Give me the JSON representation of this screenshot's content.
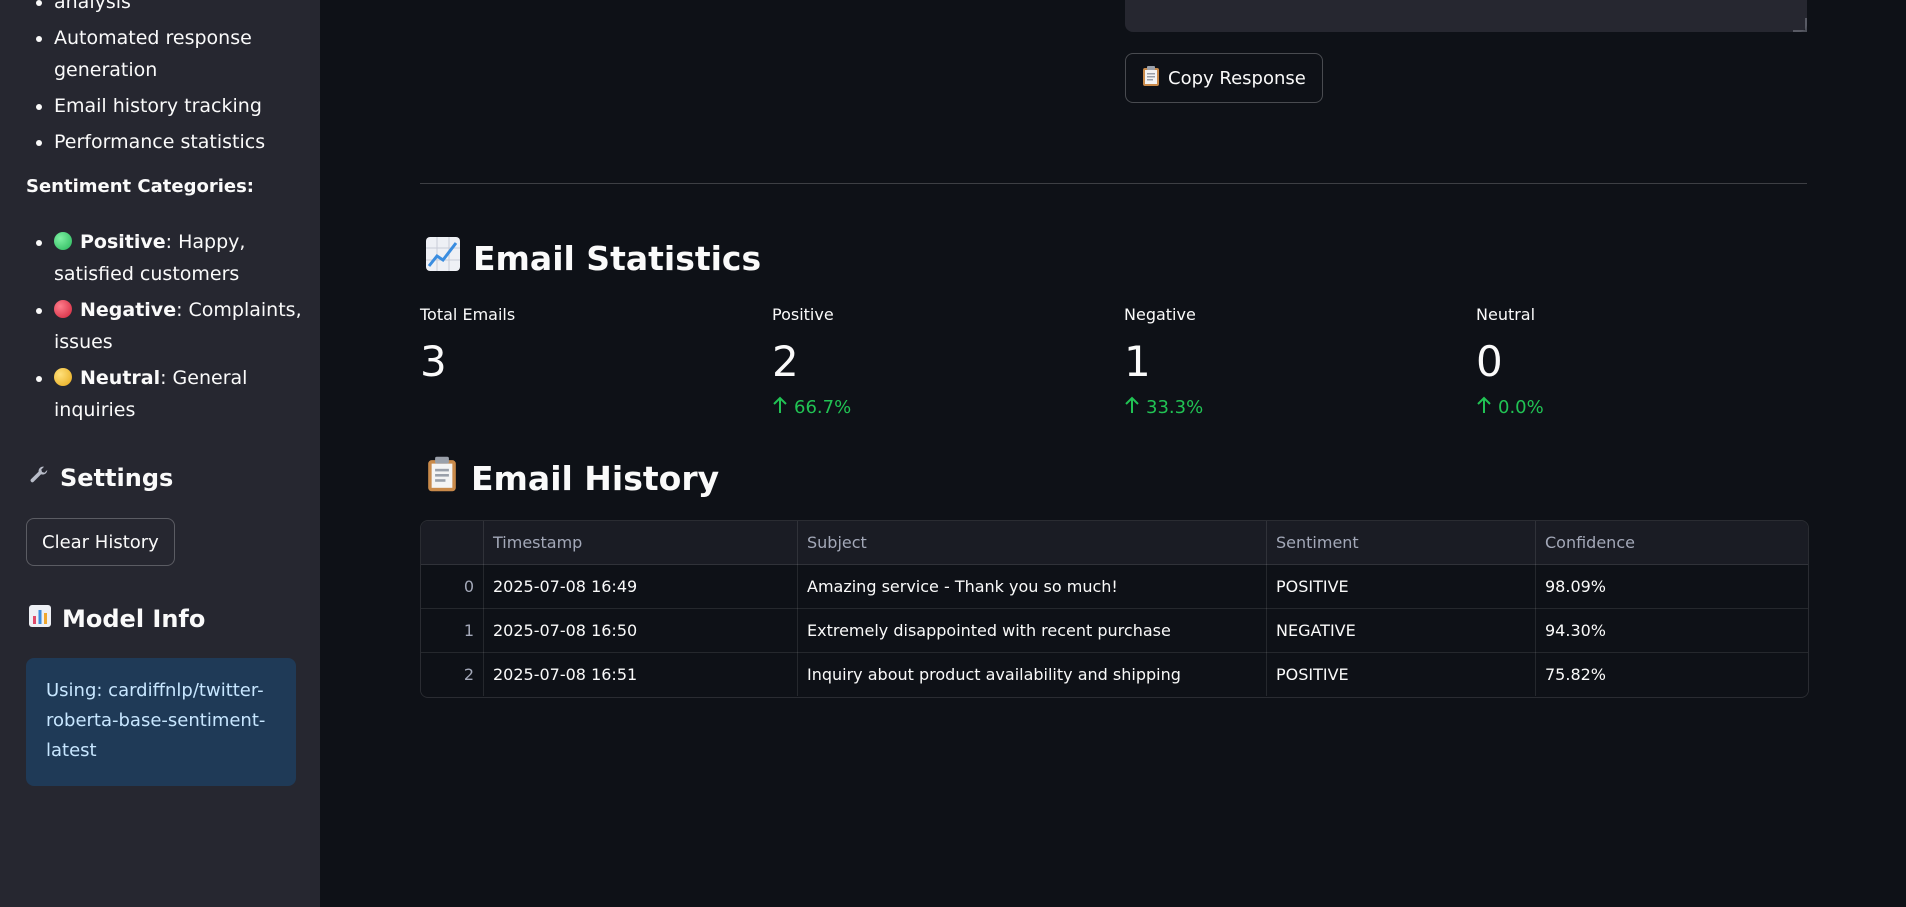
{
  "sidebar": {
    "features": [
      {
        "text": "analysis"
      },
      {
        "text": "Automated response generation"
      },
      {
        "text": "Email history tracking"
      },
      {
        "text": "Performance statistics"
      }
    ],
    "sentiment_heading": "Sentiment Categories:",
    "sentiments": [
      {
        "label": "Positive",
        "desc": ": Happy, satisfied customers",
        "color": "#3ccf6e",
        "icon": "green-circle-icon"
      },
      {
        "label": "Negative",
        "desc": ": Complaints, issues",
        "color": "#e0344a",
        "icon": "red-circle-icon"
      },
      {
        "label": "Neutral",
        "desc": ": General inquiries",
        "color": "#f2b829",
        "icon": "yellow-circle-icon"
      }
    ],
    "settings_heading": "Settings",
    "clear_history_label": "Clear History",
    "model_heading": "Model Info",
    "model_info_text": "Using: cardiffnlp/twitter-roberta-base-sentiment-latest"
  },
  "main": {
    "copy_label": "Copy Response",
    "stats_heading": "Email Statistics",
    "metrics": [
      {
        "label": "Total Emails",
        "value": "3",
        "delta": ""
      },
      {
        "label": "Positive",
        "value": "2",
        "delta": "66.7%"
      },
      {
        "label": "Negative",
        "value": "1",
        "delta": "33.3%"
      },
      {
        "label": "Neutral",
        "value": "0",
        "delta": "0.0%"
      }
    ],
    "history_heading": "Email History",
    "table": {
      "columns": [
        "",
        "Timestamp",
        "Subject",
        "Sentiment",
        "Confidence"
      ],
      "rows": [
        [
          "0",
          "2025-07-08 16:49",
          "Amazing service - Thank you so much!",
          "POSITIVE",
          "98.09%"
        ],
        [
          "1",
          "2025-07-08 16:50",
          "Extremely disappointed with recent purchase",
          "NEGATIVE",
          "94.30%"
        ],
        [
          "2",
          "2025-07-08 16:51",
          "Inquiry about product availability and shipping",
          "POSITIVE",
          "75.82%"
        ]
      ]
    }
  },
  "colors": {
    "background": "#0e1117",
    "sidebar": "#262730",
    "delta_green": "#21c354",
    "info_bg": "#1f3a57"
  }
}
